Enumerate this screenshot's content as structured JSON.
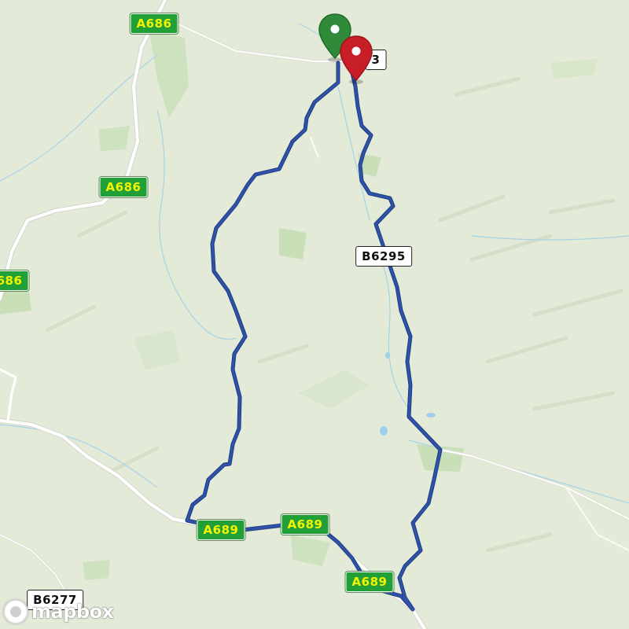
{
  "map": {
    "colors": {
      "land": "#e3ead8",
      "wood": "#c9dfb8",
      "main_road": "#ffffff",
      "road_casing": "#d4d6cc",
      "minor_road": "#f6f6f0",
      "water": "#9fd0ea",
      "route": "#2f53a8",
      "route_casing": "#1f3a80",
      "start_marker": "#2f8a3a",
      "end_marker": "#c81e28",
      "shield_a_bg": "#21a038",
      "shield_a_text": "#f4f400",
      "shield_b_bg": "#ffffff"
    },
    "road_labels": [
      {
        "text": "A686",
        "kind": "a"
      },
      {
        "text": "A686",
        "kind": "a"
      },
      {
        "text": "686",
        "kind": "a"
      },
      {
        "text": "3",
        "kind": "b"
      },
      {
        "text": "B6295",
        "kind": "b"
      },
      {
        "text": "A689",
        "kind": "a"
      },
      {
        "text": "A689",
        "kind": "a"
      },
      {
        "text": "A689",
        "kind": "a"
      },
      {
        "text": "B6277",
        "kind": "b"
      }
    ],
    "markers": [
      {
        "name": "start-marker",
        "color": "#2f8a3a",
        "icon": "map-pin-icon"
      },
      {
        "name": "end-marker",
        "color": "#c81e28",
        "icon": "map-pin-icon"
      }
    ],
    "attribution": {
      "logo_text": "mapbox",
      "icon": "mapbox-logo-icon"
    }
  }
}
